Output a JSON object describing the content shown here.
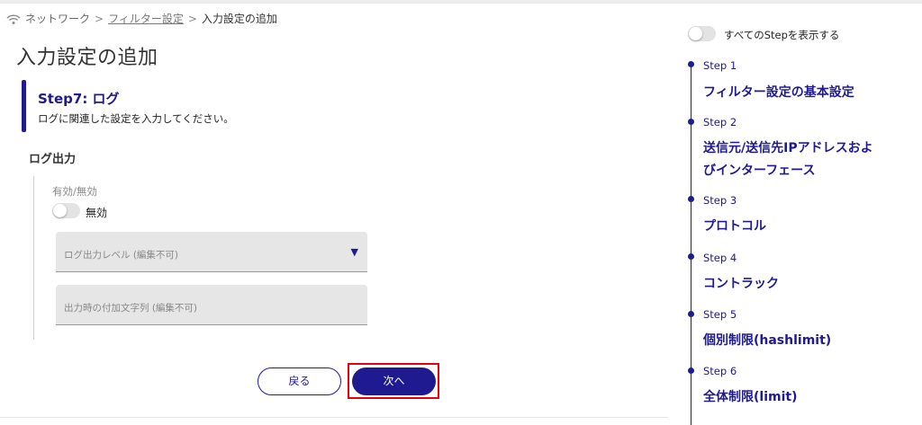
{
  "breadcrumb": {
    "root": "ネットワーク",
    "parent": "フィルター設定",
    "current": "入力設定の追加",
    "separator": ">"
  },
  "page_title": "入力設定の追加",
  "step_card": {
    "title": "Step7: ログ",
    "description": "ログに関連した設定を入力してください。"
  },
  "section": {
    "title": "ログ出力",
    "enable_label": "有効/無効",
    "enable_toggle": {
      "state": "off",
      "label": "無効"
    },
    "log_level": {
      "placeholder": "ログ出力レベル (編集不可)",
      "arrow": "▼"
    },
    "suffix_text": {
      "placeholder": "出力時の付加文字列 (編集不可)"
    }
  },
  "buttons": {
    "back": "戻る",
    "next": "次へ"
  },
  "right_panel": {
    "show_all_toggle": {
      "state": "off",
      "label": "すべてのStepを表示する"
    },
    "steps": [
      {
        "num": "Step 1",
        "name": "フィルター設定の基本設定"
      },
      {
        "num": "Step 2",
        "name": "送信元/送信先IPアドレスおよびインターフェース"
      },
      {
        "num": "Step 3",
        "name": "プロトコル"
      },
      {
        "num": "Step 4",
        "name": "コントラック"
      },
      {
        "num": "Step 5",
        "name": "個別制限(hashlimit)"
      },
      {
        "num": "Step 6",
        "name": "全体制限(limit)"
      }
    ]
  },
  "colors": {
    "accent": "#1f1a8f",
    "highlight": "#e60012",
    "field_bg": "#e6e6e6"
  },
  "icons": {
    "network": "wifi-icon",
    "dropdown": "triangle-down-icon"
  }
}
